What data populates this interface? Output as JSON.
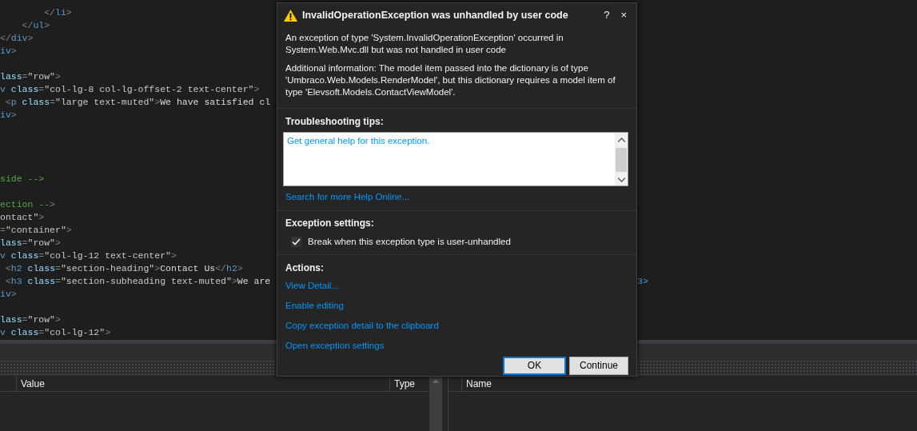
{
  "editor": {
    "lines": [
      {
        "kind": "code",
        "tokens": [
          {
            "kind": "punct",
            "text": "        </"
          },
          {
            "kind": "tag",
            "text": "li"
          },
          {
            "kind": "punct",
            "text": ">"
          }
        ]
      },
      {
        "kind": "code",
        "tokens": [
          {
            "kind": "punct",
            "text": "    </"
          },
          {
            "kind": "tag",
            "text": "ul"
          },
          {
            "kind": "punct",
            "text": ">"
          }
        ]
      },
      {
        "kind": "code",
        "tokens": [
          {
            "kind": "punct",
            "text": "</"
          },
          {
            "kind": "tag",
            "text": "div"
          },
          {
            "kind": "punct",
            "text": ">"
          }
        ]
      },
      {
        "kind": "code",
        "tokens": [
          {
            "kind": "tag",
            "text": "iv"
          },
          {
            "kind": "punct",
            "text": ">"
          }
        ]
      },
      {
        "kind": "blank"
      },
      {
        "kind": "code",
        "tokens": [
          {
            "kind": "attr",
            "text": "lass"
          },
          {
            "kind": "punct",
            "text": "="
          },
          {
            "kind": "value",
            "text": "\"row\""
          },
          {
            "kind": "punct",
            "text": ">"
          }
        ]
      },
      {
        "kind": "code",
        "tokens": [
          {
            "kind": "tag",
            "text": "v"
          },
          {
            "kind": "attr",
            "text": " class"
          },
          {
            "kind": "punct",
            "text": "="
          },
          {
            "kind": "value",
            "text": "\"col-lg-8 col-lg-offset-2 text-center\""
          },
          {
            "kind": "punct",
            "text": ">"
          }
        ]
      },
      {
        "kind": "code",
        "tokens": [
          {
            "kind": "punct",
            "text": " <"
          },
          {
            "kind": "tag",
            "text": "p"
          },
          {
            "kind": "attr",
            "text": " class"
          },
          {
            "kind": "punct",
            "text": "="
          },
          {
            "kind": "value",
            "text": "\"large text-muted\""
          },
          {
            "kind": "punct",
            "text": ">"
          },
          {
            "kind": "text",
            "text": "We have satisfied cl"
          }
        ]
      },
      {
        "kind": "code",
        "tokens": [
          {
            "kind": "tag",
            "text": "iv"
          },
          {
            "kind": "punct",
            "text": ">"
          }
        ]
      },
      {
        "kind": "blank"
      },
      {
        "kind": "blank"
      },
      {
        "kind": "blank"
      },
      {
        "kind": "blank"
      },
      {
        "kind": "code",
        "tokens": [
          {
            "kind": "comment",
            "text": "side -->"
          }
        ]
      },
      {
        "kind": "blank"
      },
      {
        "kind": "code",
        "tokens": [
          {
            "kind": "comment",
            "text": "ection -->"
          }
        ]
      },
      {
        "kind": "code",
        "tokens": [
          {
            "kind": "value",
            "text": "ontact\""
          },
          {
            "kind": "punct",
            "text": ">"
          }
        ]
      },
      {
        "kind": "code",
        "tokens": [
          {
            "kind": "punct",
            "text": "="
          },
          {
            "kind": "value",
            "text": "\"container\""
          },
          {
            "kind": "punct",
            "text": ">"
          }
        ]
      },
      {
        "kind": "code",
        "tokens": [
          {
            "kind": "attr",
            "text": "lass"
          },
          {
            "kind": "punct",
            "text": "="
          },
          {
            "kind": "value",
            "text": "\"row\""
          },
          {
            "kind": "punct",
            "text": ">"
          }
        ]
      },
      {
        "kind": "code",
        "tokens": [
          {
            "kind": "tag",
            "text": "v"
          },
          {
            "kind": "attr",
            "text": " class"
          },
          {
            "kind": "punct",
            "text": "="
          },
          {
            "kind": "value",
            "text": "\"col-lg-12 text-center\""
          },
          {
            "kind": "punct",
            "text": ">"
          }
        ]
      },
      {
        "kind": "code",
        "tokens": [
          {
            "kind": "punct",
            "text": " <"
          },
          {
            "kind": "tag",
            "text": "h2"
          },
          {
            "kind": "attr",
            "text": " class"
          },
          {
            "kind": "punct",
            "text": "="
          },
          {
            "kind": "value",
            "text": "\"section-heading\""
          },
          {
            "kind": "punct",
            "text": ">"
          },
          {
            "kind": "text",
            "text": "Contact Us"
          },
          {
            "kind": "punct",
            "text": "</"
          },
          {
            "kind": "tag",
            "text": "h2"
          },
          {
            "kind": "punct",
            "text": ">"
          }
        ]
      },
      {
        "kind": "code",
        "tokens": [
          {
            "kind": "punct",
            "text": " <"
          },
          {
            "kind": "tag",
            "text": "h3"
          },
          {
            "kind": "attr",
            "text": " class"
          },
          {
            "kind": "punct",
            "text": "="
          },
          {
            "kind": "value",
            "text": "\"section-subheading text-muted\""
          },
          {
            "kind": "punct",
            "text": ">"
          },
          {
            "kind": "text",
            "text": "We are"
          }
        ],
        "right_tokens": [
          {
            "kind": "tag",
            "text": "3>"
          }
        ]
      },
      {
        "kind": "code",
        "tokens": [
          {
            "kind": "tag",
            "text": "iv"
          },
          {
            "kind": "punct",
            "text": ">"
          }
        ]
      },
      {
        "kind": "blank"
      },
      {
        "kind": "code",
        "tokens": [
          {
            "kind": "attr",
            "text": "lass"
          },
          {
            "kind": "punct",
            "text": "="
          },
          {
            "kind": "value",
            "text": "\"row\""
          },
          {
            "kind": "punct",
            "text": ">"
          }
        ]
      },
      {
        "kind": "code",
        "tokens": [
          {
            "kind": "tag",
            "text": "v"
          },
          {
            "kind": "attr",
            "text": " class"
          },
          {
            "kind": "punct",
            "text": "="
          },
          {
            "kind": "value",
            "text": "\"col-lg-12\""
          },
          {
            "kind": "punct",
            "text": ">"
          }
        ]
      }
    ]
  },
  "dialog": {
    "title": "InvalidOperationException was unhandled by user code",
    "help_button": "?",
    "close_button": "×",
    "message": [
      "An exception of type 'System.InvalidOperationException' occurred in System.Web.Mvc.dll but was not handled in user code",
      "Additional information: The model item passed into the dictionary is of type 'Umbraco.Web.Models.RenderModel', but this dictionary requires a model item of type 'Elevsoft.Models.ContactViewModel'."
    ],
    "tips_heading": "Troubleshooting tips:",
    "tips": [
      "Get general help for this exception."
    ],
    "search_link": "Search for more Help Online...",
    "settings_heading": "Exception settings:",
    "settings": [
      {
        "label": "Break when this exception type is user-unhandled",
        "checked": true
      }
    ],
    "actions_heading": "Actions:",
    "actions": [
      "View Detail...",
      "Enable editing",
      "Copy exception detail to the clipboard",
      "Open exception settings"
    ],
    "buttons": [
      {
        "label": "OK",
        "focused": true
      },
      {
        "label": "Continue",
        "focused": false
      }
    ]
  },
  "locals": {
    "columns": [
      "Value",
      "Type"
    ]
  },
  "watch": {
    "columns": [
      "Name"
    ]
  }
}
